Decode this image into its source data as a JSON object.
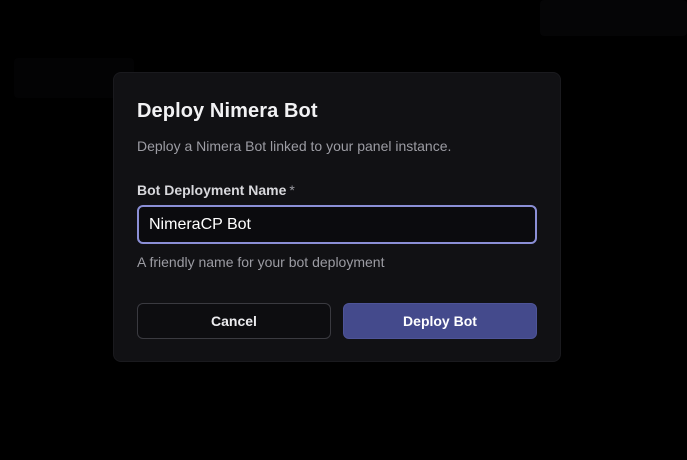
{
  "dialog": {
    "title": "Deploy Nimera Bot",
    "description": "Deploy a Nimera Bot linked to your panel instance.",
    "field": {
      "label": "Bot Deployment Name",
      "required_marker": "*",
      "value": "NimeraCP Bot",
      "hint": "A friendly name for your bot deployment"
    },
    "actions": {
      "cancel_label": "Cancel",
      "deploy_label": "Deploy Bot"
    }
  },
  "colors": {
    "background": "#000000",
    "modal": "#111114",
    "accent": "#444a8c",
    "focus_ring": "#8b8fd6"
  }
}
